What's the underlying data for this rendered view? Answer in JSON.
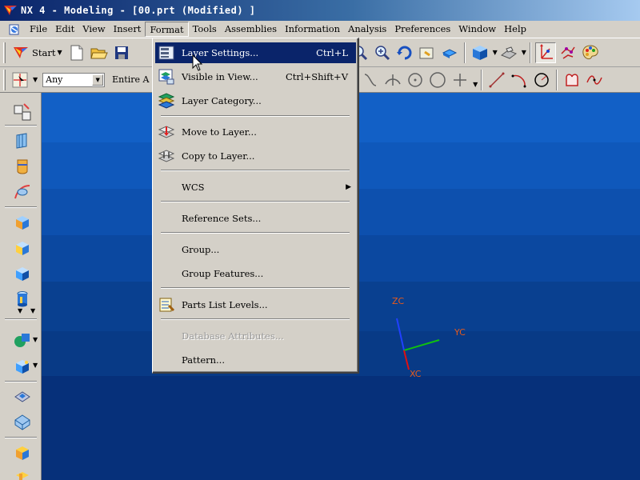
{
  "window": {
    "title": "NX 4 - Modeling - [00.prt (Modified) ]"
  },
  "menubar": {
    "items": [
      "File",
      "Edit",
      "View",
      "Insert",
      "Format",
      "Tools",
      "Assemblies",
      "Information",
      "Analysis",
      "Preferences",
      "Window",
      "Help"
    ],
    "active": "Format"
  },
  "toolbar": {
    "start_label": "Start",
    "filter_value": "Any",
    "scope_value": "Entire A"
  },
  "format_menu": {
    "items": [
      {
        "label": "Layer Settings...",
        "shortcut": "Ctrl+L",
        "icon": "layer-settings-icon",
        "state": "highlighted"
      },
      {
        "label": "Visible in View...",
        "shortcut": "Ctrl+Shift+V",
        "icon": "visible-in-view-icon",
        "state": "normal"
      },
      {
        "label": "Layer Category...",
        "shortcut": "",
        "icon": "layer-category-icon",
        "state": "normal"
      },
      {
        "label": "Move to Layer...",
        "shortcut": "",
        "icon": "move-to-layer-icon",
        "state": "normal"
      },
      {
        "label": "Copy to Layer...",
        "shortcut": "",
        "icon": "copy-to-layer-icon",
        "state": "normal"
      },
      {
        "label": "WCS",
        "shortcut": "",
        "icon": "",
        "state": "submenu"
      },
      {
        "label": "Reference Sets...",
        "shortcut": "",
        "icon": "",
        "state": "normal"
      },
      {
        "label": "Group...",
        "shortcut": "",
        "icon": "",
        "state": "normal"
      },
      {
        "label": "Group Features...",
        "shortcut": "",
        "icon": "",
        "state": "normal"
      },
      {
        "label": "Parts List Levels...",
        "shortcut": "",
        "icon": "parts-list-levels-icon",
        "state": "normal"
      },
      {
        "label": "Database Attributes...",
        "shortcut": "",
        "icon": "",
        "state": "disabled"
      },
      {
        "label": "Pattern...",
        "shortcut": "",
        "icon": "",
        "state": "normal"
      }
    ]
  },
  "viewport": {
    "axes": {
      "z": "ZC",
      "y": "YC",
      "x": "XC"
    },
    "colors": {
      "x_axis": "#e01010",
      "y_axis": "#10c010",
      "z_axis": "#2040ff",
      "label": "#e85a1a"
    }
  }
}
